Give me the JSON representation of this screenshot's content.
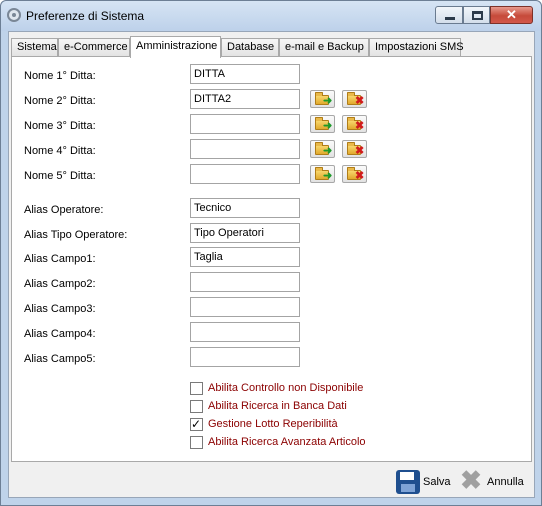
{
  "window": {
    "title": "Preferenze di Sistema",
    "close_glyph": "✕"
  },
  "tabs": [
    {
      "label": "Sistema"
    },
    {
      "label": "e-Commerce"
    },
    {
      "label": "Amministrazione"
    },
    {
      "label": "Database"
    },
    {
      "label": "e-mail e Backup"
    },
    {
      "label": "Impostazioni SMS"
    }
  ],
  "active_tab": "Amministrazione",
  "ditte": [
    {
      "label": "Nome 1° Ditta:",
      "value": "DITTA"
    },
    {
      "label": "Nome 2° Ditta:",
      "value": "DITTA2"
    },
    {
      "label": "Nome 3° Ditta:",
      "value": ""
    },
    {
      "label": "Nome 4° Ditta:",
      "value": ""
    },
    {
      "label": "Nome 5° Ditta:",
      "value": ""
    }
  ],
  "icons": {
    "folder_add": "folder-add-icon",
    "folder_delete": "folder-delete-icon",
    "add_mark": "➜",
    "delete_mark": "✖"
  },
  "alias": [
    {
      "label": "Alias Operatore:",
      "value": "Tecnico"
    },
    {
      "label": "Alias Tipo Operatore:",
      "value": "Tipo Operatori"
    },
    {
      "label": "Alias Campo1:",
      "value": "Taglia"
    },
    {
      "label": "Alias Campo2:",
      "value": ""
    },
    {
      "label": "Alias Campo3:",
      "value": ""
    },
    {
      "label": "Alias Campo4:",
      "value": ""
    },
    {
      "label": "Alias Campo5:",
      "value": ""
    }
  ],
  "options": [
    {
      "label": "Abilita Controllo non Disponibile",
      "checked": false
    },
    {
      "label": "Abilita Ricerca in Banca Dati",
      "checked": false
    },
    {
      "label": "Gestione Lotto Reperibilità",
      "checked": true
    },
    {
      "label": "Abilita Ricerca Avanzata Articolo",
      "checked": false
    }
  ],
  "footer": {
    "save_label": "Salva",
    "cancel_label": "Annulla",
    "cancel_glyph": "✖"
  },
  "colors": {
    "option_text": "#8b0000",
    "titlebar": "#bdd1ea",
    "close_button": "#c64a3a"
  }
}
